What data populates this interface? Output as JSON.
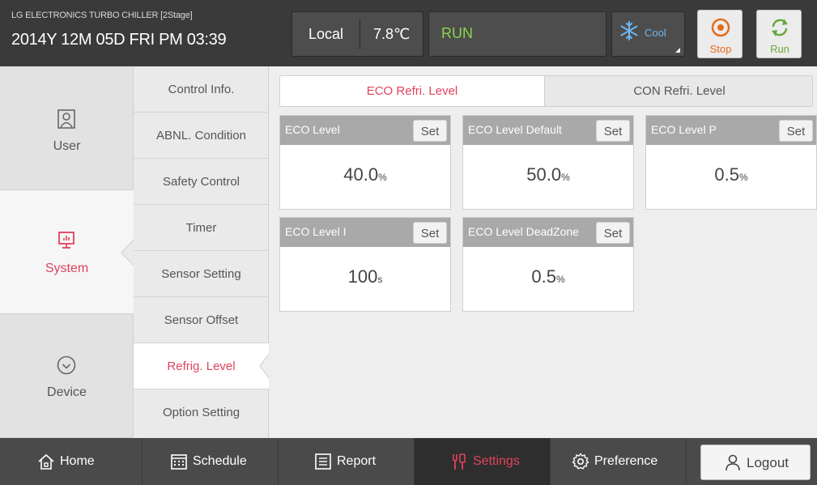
{
  "header": {
    "brand": "LG ELECTRONICS TURBO CHILLER [2Stage]",
    "datetime": "2014Y 12M 05D  FRI PM 03:39",
    "mode_local": "Local",
    "temperature": "7.8℃",
    "run_status": "RUN",
    "operation_mode": "Cool",
    "stop_label": "Stop",
    "run_label": "Run",
    "colors": {
      "run_status": "#8bd44a",
      "stop": "#e66b1a",
      "run": "#68a83a",
      "accent": "#e0435c"
    }
  },
  "categories": [
    {
      "label": "User",
      "icon": "user-icon"
    },
    {
      "label": "System",
      "icon": "monitor-icon",
      "selected": true
    },
    {
      "label": "Device",
      "icon": "check-circle-icon"
    }
  ],
  "submenu": [
    {
      "label": "Control Info."
    },
    {
      "label": "ABNL. Condition"
    },
    {
      "label": "Safety Control"
    },
    {
      "label": "Timer"
    },
    {
      "label": "Sensor Setting"
    },
    {
      "label": "Sensor Offset"
    },
    {
      "label": "Refrig. Level",
      "active": true
    },
    {
      "label": "Option Setting"
    }
  ],
  "tabs": [
    {
      "label": "ECO Refri. Level",
      "active": true
    },
    {
      "label": "CON Refri. Level"
    }
  ],
  "cards": [
    {
      "title": "ECO Level",
      "value": "40.0",
      "unit": "%",
      "set_label": "Set"
    },
    {
      "title": "ECO Level Default",
      "value": "50.0",
      "unit": "%",
      "set_label": "Set"
    },
    {
      "title": "ECO Level P",
      "value": "0.5",
      "unit": "%",
      "set_label": "Set"
    },
    {
      "title": "ECO Level I",
      "value": "100",
      "unit": "s",
      "set_label": "Set"
    },
    {
      "title": "ECO Level DeadZone",
      "value": "0.5",
      "unit": "%",
      "set_label": "Set"
    }
  ],
  "bottom_nav": {
    "home": "Home",
    "schedule": "Schedule",
    "report": "Report",
    "settings": "Settings",
    "preference": "Preference",
    "logout": "Logout"
  }
}
